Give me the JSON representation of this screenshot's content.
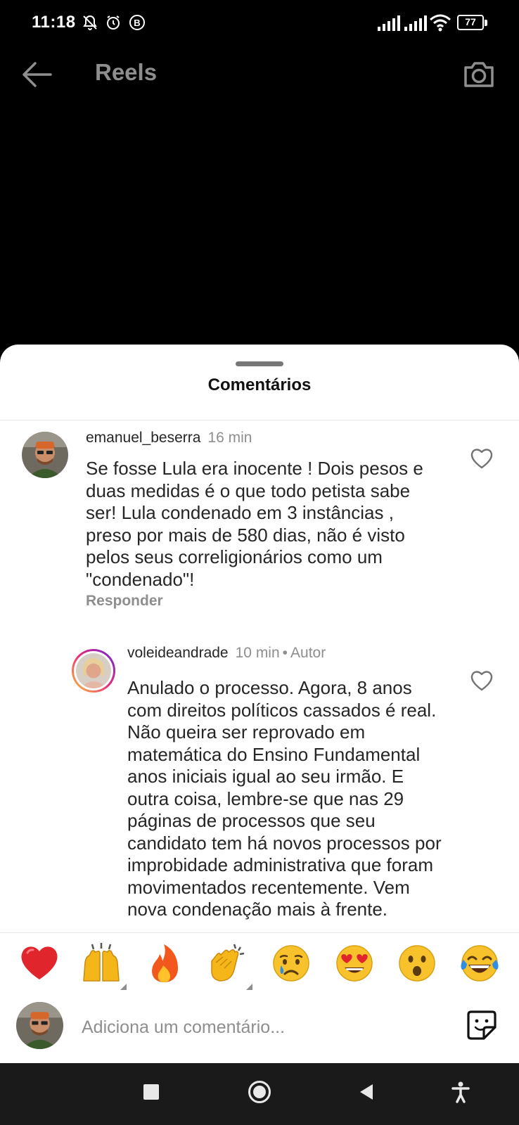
{
  "status_bar": {
    "time": "11:18",
    "battery": "77",
    "icons": [
      "notifications-muted-icon",
      "alarm-icon",
      "b-badge-icon",
      "signal-icon",
      "signal-icon",
      "wifi-icon",
      "battery-icon"
    ]
  },
  "top_nav": {
    "title": "Reels",
    "back_icon": "arrow-left-icon",
    "camera_icon": "camera-icon"
  },
  "sheet": {
    "title": "Comentários"
  },
  "comments": [
    {
      "username": "emanuel_beserra",
      "time": "16 min",
      "text": "Se fosse Lula era inocente ! Dois pesos e duas medidas é o que todo petista sabe ser! Lula condenado em 3 instâncias , preso por mais de 580 dias, não é visto pelos seus correligionários como um \"condenado\"!",
      "reply_label": "Responder"
    },
    {
      "username": "voleideandrade",
      "time": "10 min",
      "separator": "•",
      "badge": "Autor",
      "text": "Anulado o processo. Agora, 8 anos com direitos políticos cassados é real. Não queira ser reprovado em matemática do Ensino Fundamental anos iniciais igual ao seu irmão. E outra coisa, lembre-se que nas 29 páginas de processos que seu candidato tem há novos processos por improbidade administrativa que foram movimentados recentemente. Vem nova condenação mais à frente."
    }
  ],
  "emoji_bar": [
    "❤️",
    "🙌",
    "🔥",
    "👏",
    "😢",
    "😍",
    "😮",
    "😂"
  ],
  "composer": {
    "placeholder": "Adiciona um comentário...",
    "sticker_icon": "sticker-icon"
  },
  "android_nav": [
    "recents-square-icon",
    "home-circle-icon",
    "back-triangle-icon",
    "accessibility-icon"
  ]
}
